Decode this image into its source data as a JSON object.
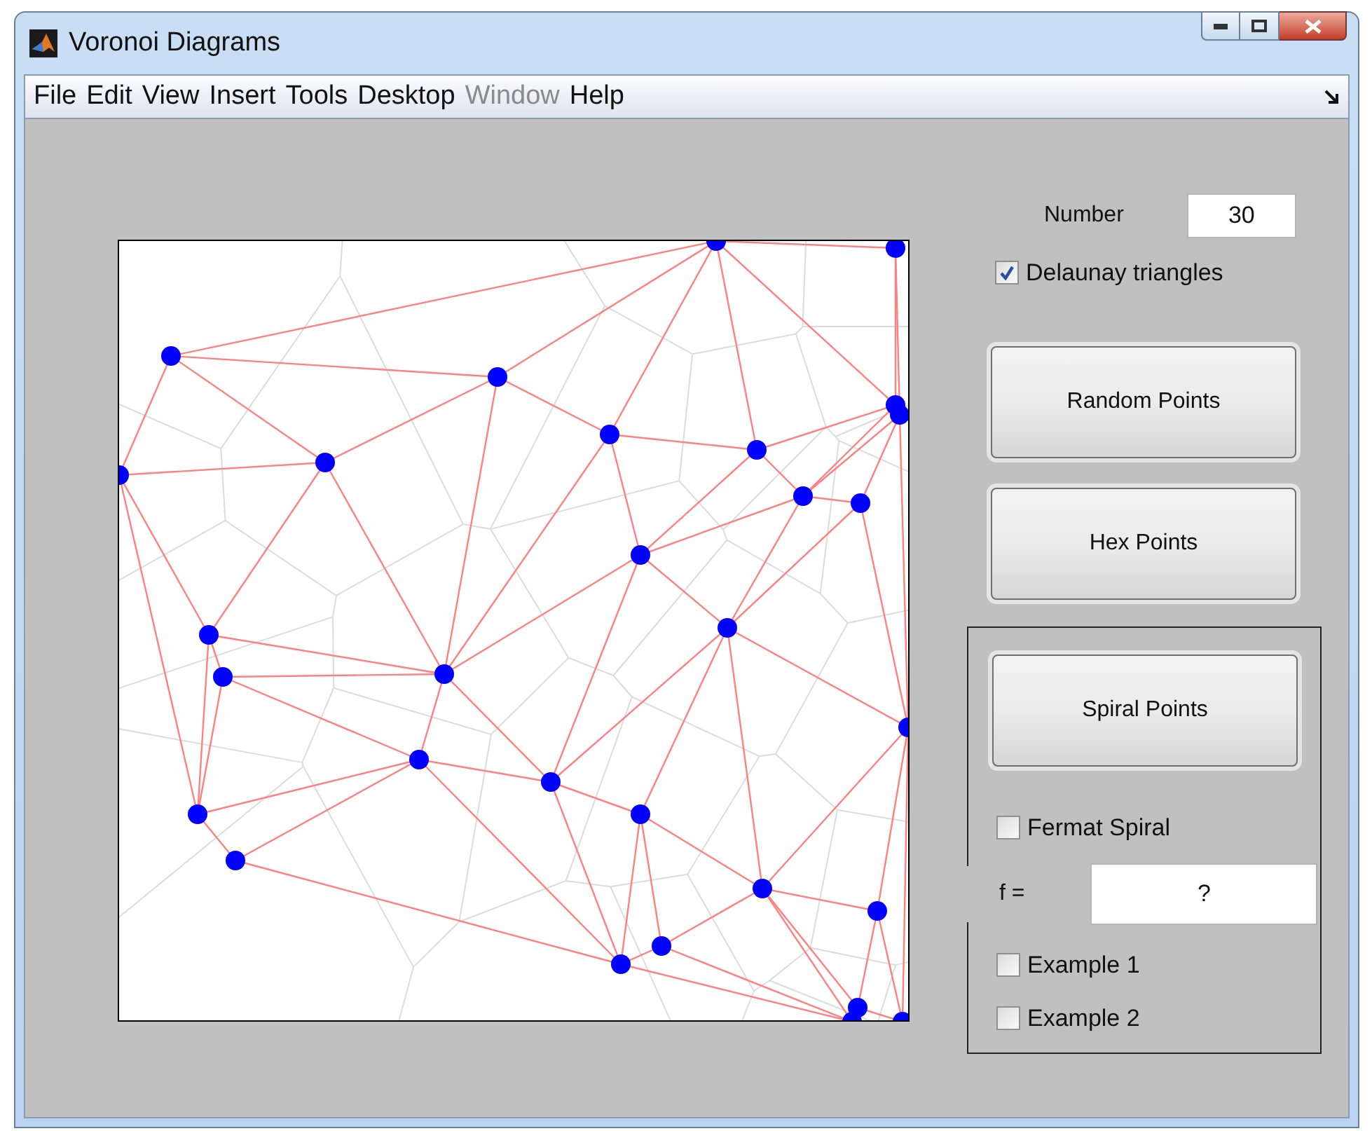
{
  "window": {
    "title": "Voronoi Diagrams"
  },
  "menu": [
    {
      "label": "File",
      "disabled": false
    },
    {
      "label": "Edit",
      "disabled": false
    },
    {
      "label": "View",
      "disabled": false
    },
    {
      "label": "Insert",
      "disabled": false
    },
    {
      "label": "Tools",
      "disabled": false
    },
    {
      "label": "Desktop",
      "disabled": false
    },
    {
      "label": "Window",
      "disabled": true
    },
    {
      "label": "Help",
      "disabled": false
    }
  ],
  "number": {
    "label": "Number",
    "value": "30"
  },
  "delaunay": {
    "label": "Delaunay triangles",
    "checked": true
  },
  "buttons": [
    "Random Points",
    "Hex Points"
  ],
  "spiral_group": {
    "button": "Spiral Points",
    "fermat": {
      "label": "Fermat Spiral",
      "checked": false
    },
    "f": {
      "label": "f =",
      "value": "?"
    },
    "examples": [
      {
        "label": "Example 1",
        "checked": false
      },
      {
        "label": "Example 2",
        "checked": false
      }
    ]
  }
}
